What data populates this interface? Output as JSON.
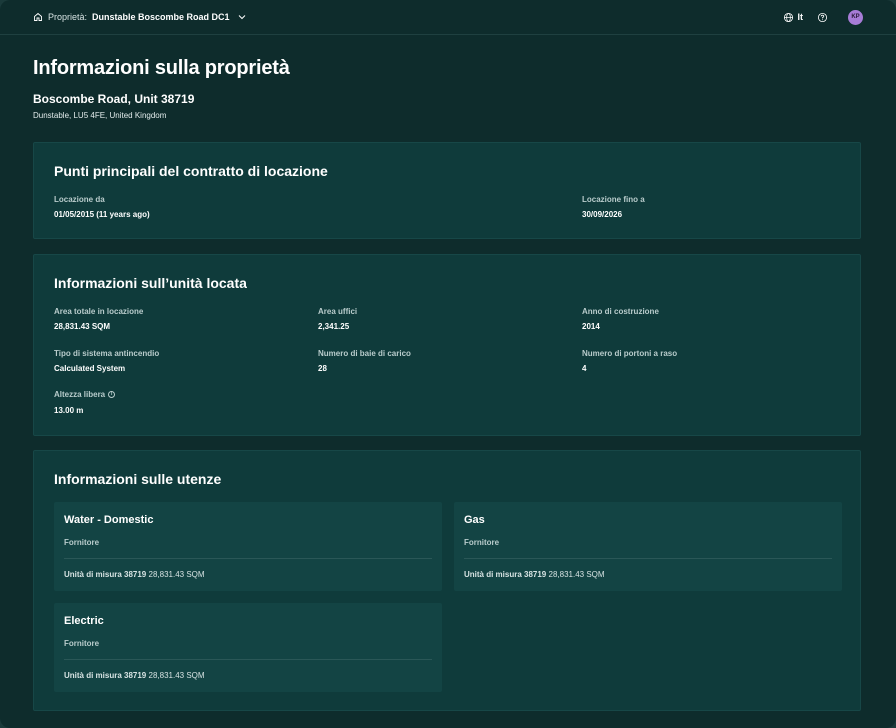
{
  "topbar": {
    "breadcrumb_label": "Proprietà:",
    "breadcrumb_value": "Dunstable Boscombe Road DC1",
    "language": "It",
    "avatar_initials": "KP"
  },
  "page": {
    "title": "Informazioni sulla proprietà",
    "property_name": "Boscombe Road, Unit 38719",
    "property_address": "Dunstable, LU5 4FE, United Kingdom"
  },
  "lease": {
    "title": "Punti principali del contratto di locazione",
    "from_label": "Locazione da",
    "from_value": "01/05/2015 (11 years ago)",
    "to_label": "Locazione fino a",
    "to_value": "30/09/2026"
  },
  "unit": {
    "title": "Informazioni sull’unità locata",
    "fields": [
      {
        "label": "Area totale in locazione",
        "value": "28,831.43 SQM"
      },
      {
        "label": "Area uffici",
        "value": "2,341.25"
      },
      {
        "label": "Anno di costruzione",
        "value": "2014"
      },
      {
        "label": "Tipo di sistema antincendio",
        "value": "Calculated System"
      },
      {
        "label": "Numero di baie di carico",
        "value": "28"
      },
      {
        "label": "Numero di portoni a raso",
        "value": "4"
      },
      {
        "label": "Altezza libera",
        "value": "13.00 m"
      }
    ]
  },
  "utilities": {
    "title": "Informazioni sulle utenze",
    "items": [
      {
        "name": "Water - Domestic",
        "supplier_label": "Fornitore",
        "meter_label": "Unità di misura 38719",
        "meter_value": "28,831.43 SQM"
      },
      {
        "name": "Gas",
        "supplier_label": "Fornitore",
        "meter_label": "Unità di misura 38719",
        "meter_value": "28,831.43 SQM"
      },
      {
        "name": "Electric",
        "supplier_label": "Fornitore",
        "meter_label": "Unità di misura 38719",
        "meter_value": "28,831.43 SQM"
      }
    ]
  },
  "icons": {
    "home": "home-icon",
    "chevron": "chevron-down-icon",
    "globe": "globe-icon",
    "help": "help-icon",
    "info": "info-icon"
  },
  "colors": {
    "background": "#0e2c2c",
    "card": "#0f3b3b",
    "utility_card": "#134444",
    "avatar": "#a77cd7"
  }
}
